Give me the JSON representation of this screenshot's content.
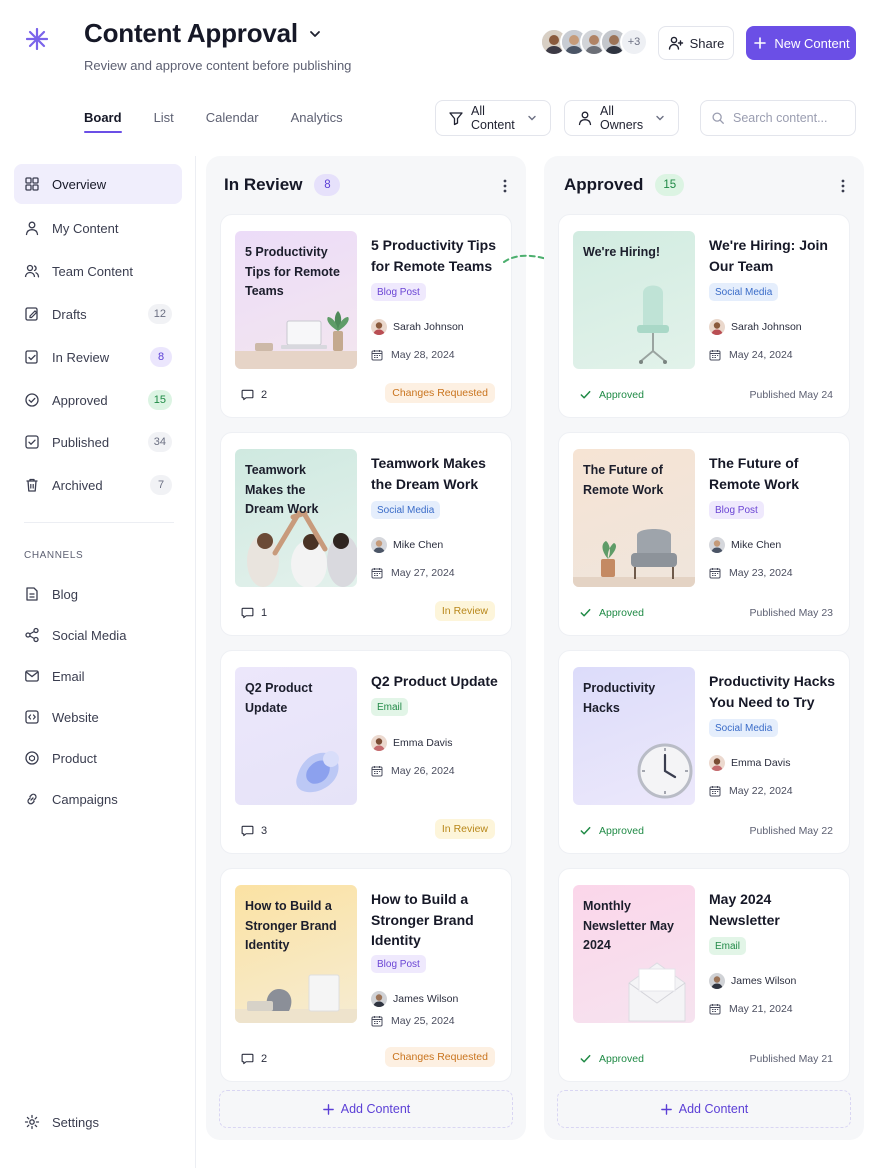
{
  "header": {
    "title": "Content Approval",
    "subtitle": "Review and approve content before publishing",
    "avatars_more": "+3",
    "share_label": "Share",
    "new_content_label": "New Content"
  },
  "tabs": [
    {
      "label": "Board",
      "active": true
    },
    {
      "label": "List"
    },
    {
      "label": "Calendar"
    },
    {
      "label": "Analytics"
    }
  ],
  "filters": {
    "content": "All Content",
    "owners": "All Owners",
    "search_placeholder": "Search content..."
  },
  "sidebar": {
    "items": [
      {
        "label": "Overview",
        "icon": "grid-icon"
      },
      {
        "label": "My Content",
        "icon": "user-icon"
      },
      {
        "label": "Team Content",
        "icon": "users-icon"
      },
      {
        "label": "Drafts",
        "count": "12",
        "icon": "edit-icon"
      },
      {
        "label": "In Review",
        "count": "8",
        "icon": "review-icon"
      },
      {
        "label": "Approved",
        "count": "15",
        "icon": "check-circle-icon"
      },
      {
        "label": "Published",
        "count": "34",
        "icon": "check-square-icon"
      },
      {
        "label": "Archived",
        "count": "7",
        "icon": "trash-icon"
      }
    ],
    "channels_heading": "CHANNELS",
    "channels": [
      {
        "label": "Blog",
        "icon": "document-icon"
      },
      {
        "label": "Social Media",
        "icon": "share-icon"
      },
      {
        "label": "Email",
        "icon": "mail-icon"
      },
      {
        "label": "Website",
        "icon": "code-icon"
      },
      {
        "label": "Product",
        "icon": "box-icon"
      },
      {
        "label": "Campaigns",
        "icon": "link-icon"
      }
    ],
    "settings_label": "Settings"
  },
  "columns": [
    {
      "title": "In Review",
      "count": "8",
      "add_label": "Add Content",
      "cards": [
        {
          "thumb_text": "5 Productivity Tips for Remote Teams",
          "title": "5 Productivity Tips for Remote Teams",
          "tag": "Blog Post",
          "owner": "Sarah Johnson",
          "date": "May 28, 2024",
          "comments": "2",
          "status": "Changes Requested"
        },
        {
          "thumb_text": "Teamwork Makes the Dream Work",
          "title": "Teamwork Makes the Dream Work",
          "tag": "Social Media",
          "owner": "Mike Chen",
          "date": "May 27, 2024",
          "comments": "1",
          "status": "In Review"
        },
        {
          "thumb_text": "Q2 Product Update",
          "title": "Q2 Product Update",
          "tag": "Email",
          "owner": "Emma Davis",
          "date": "May 26, 2024",
          "comments": "3",
          "status": "In Review"
        },
        {
          "thumb_text": "How to Build a Stronger Brand Identity",
          "title": "How to Build a Stronger Brand Identity",
          "tag": "Blog Post",
          "owner": "James Wilson",
          "date": "May 25, 2024",
          "comments": "2",
          "status": "Changes Requested"
        }
      ]
    },
    {
      "title": "Approved",
      "count": "15",
      "add_label": "Add Content",
      "cards": [
        {
          "thumb_text": "We're Hiring!",
          "title": "We're Hiring: Join Our Team",
          "tag": "Social Media",
          "owner": "Sarah Johnson",
          "date": "May 24, 2024",
          "status": "Approved",
          "published": "Published May 24"
        },
        {
          "thumb_text": "The Future of Remote Work",
          "title": "The Future of Remote Work",
          "tag": "Blog Post",
          "owner": "Mike Chen",
          "date": "May 23, 2024",
          "status": "Approved",
          "published": "Published May 23"
        },
        {
          "thumb_text": "Productivity Hacks",
          "title": "Productivity Hacks You Need to Try",
          "tag": "Social Media",
          "owner": "Emma Davis",
          "date": "May 22, 2024",
          "status": "Approved",
          "published": "Published May 22"
        },
        {
          "thumb_text": "Monthly Newsletter May 2024",
          "title": "May 2024 Newsletter",
          "tag": "Email",
          "owner": "James Wilson",
          "date": "May 21, 2024",
          "status": "Approved",
          "published": "Published May 21"
        }
      ]
    }
  ],
  "colors": {
    "accent": "#6b4fe6",
    "approved": "#1f8a45",
    "changes_requested": "#c9741e",
    "in_review": "#b8871a"
  }
}
